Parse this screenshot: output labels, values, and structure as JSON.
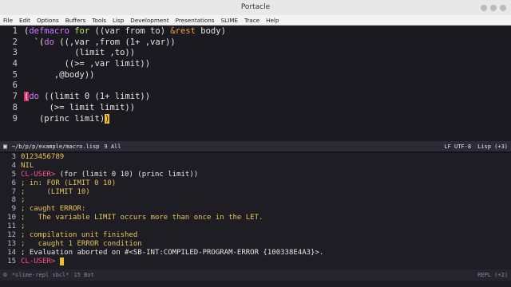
{
  "window": {
    "title": "Portacle"
  },
  "menu": [
    "File",
    "Edit",
    "Options",
    "Buffers",
    "Tools",
    "Lisp",
    "Development",
    "Presentations",
    "SLIME",
    "Trace",
    "Help"
  ],
  "editor": {
    "lines": [
      {
        "n": "1",
        "segs": [
          {
            "t": "(",
            "c": "plain"
          },
          {
            "t": "defmacro",
            "c": "kw"
          },
          {
            "t": " ",
            "c": "plain"
          },
          {
            "t": "for",
            "c": "fn"
          },
          {
            "t": " ((var from to) ",
            "c": "plain"
          },
          {
            "t": "&rest",
            "c": "or"
          },
          {
            "t": " body)",
            "c": "plain"
          }
        ]
      },
      {
        "n": "2",
        "segs": [
          {
            "t": "  `(",
            "c": "plain"
          },
          {
            "t": "do",
            "c": "kw"
          },
          {
            "t": " ((,var ,from (1+ ,var))",
            "c": "plain"
          }
        ]
      },
      {
        "n": "3",
        "segs": [
          {
            "t": "          (limit ,to))",
            "c": "plain"
          }
        ]
      },
      {
        "n": "4",
        "segs": [
          {
            "t": "        ((>= ,var limit))",
            "c": "plain"
          }
        ]
      },
      {
        "n": "5",
        "segs": [
          {
            "t": "      ,@body))",
            "c": "plain"
          }
        ]
      },
      {
        "n": "6",
        "segs": []
      },
      {
        "n": "7",
        "segs": [
          {
            "t": "(",
            "c": "paren"
          },
          {
            "t": "do",
            "c": "kw"
          },
          {
            "t": " ((limit 0 (1+ limit))",
            "c": "plain"
          }
        ]
      },
      {
        "n": "8",
        "segs": [
          {
            "t": "     (>= limit limit))",
            "c": "plain"
          }
        ]
      },
      {
        "n": "9",
        "segs": [
          {
            "t": "   (princ limit)",
            "c": "plain"
          },
          {
            "t": ")",
            "c": "cursor"
          }
        ]
      }
    ]
  },
  "modeline_top": {
    "buffer": "~/b/p/p/example/macro.lisp",
    "position": "9 All",
    "encoding": "LF UTF-8",
    "mode": "Lisp (+3)"
  },
  "repl": {
    "lines": [
      {
        "n": "3",
        "segs": [
          {
            "t": "0123456789",
            "c": "cm"
          }
        ]
      },
      {
        "n": "4",
        "segs": [
          {
            "t": "NIL",
            "c": "cm"
          }
        ]
      },
      {
        "n": "5",
        "segs": [
          {
            "t": "CL-USER>",
            "c": "prompt"
          },
          {
            "t": " (for (limit 0 10) (princ limit))",
            "c": "plain"
          }
        ]
      },
      {
        "n": "6",
        "segs": [
          {
            "t": "; in: FOR (LIMIT 0 10)",
            "c": "cm"
          }
        ]
      },
      {
        "n": "7",
        "segs": [
          {
            "t": ";     (LIMIT 10)",
            "c": "cm"
          }
        ]
      },
      {
        "n": "8",
        "segs": [
          {
            "t": ";",
            "c": "cm"
          }
        ]
      },
      {
        "n": "9",
        "segs": [
          {
            "t": "; caught ERROR:",
            "c": "cm"
          }
        ]
      },
      {
        "n": "10",
        "segs": [
          {
            "t": ";   The variable LIMIT occurs more than once in the LET.",
            "c": "cm"
          }
        ]
      },
      {
        "n": "11",
        "segs": [
          {
            "t": ";",
            "c": "cm"
          }
        ]
      },
      {
        "n": "12",
        "segs": [
          {
            "t": "; compilation unit finished",
            "c": "cm"
          }
        ]
      },
      {
        "n": "13",
        "segs": [
          {
            "t": ";   caught 1 ERROR condition",
            "c": "cm"
          }
        ]
      },
      {
        "n": "14",
        "segs": [
          {
            "t": "; Evaluation aborted on #<SB-INT:COMPILED-PROGRAM-ERROR {100338E4A3}>.",
            "c": "plain"
          }
        ]
      },
      {
        "n": "15",
        "segs": [
          {
            "t": "CL-USER>",
            "c": "prompt"
          },
          {
            "t": " ",
            "c": "plain"
          },
          {
            "t": " ",
            "c": "cursor"
          }
        ]
      }
    ]
  },
  "modeline_bottom": {
    "buffer": "*slime-repl sbcl*",
    "position": "15 Bot",
    "mode": "REPL (+2)"
  }
}
